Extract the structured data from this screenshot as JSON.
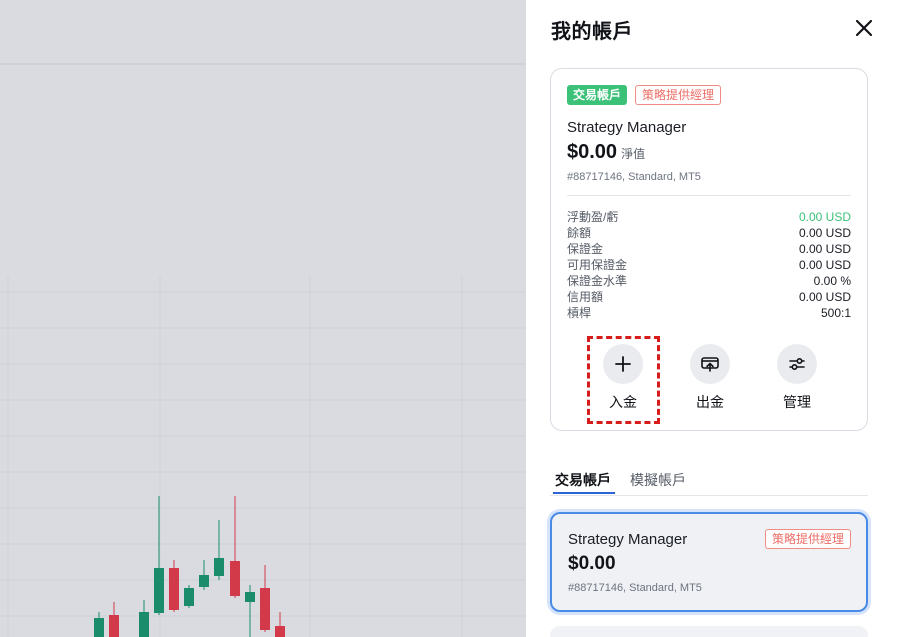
{
  "panel": {
    "title": "我的帳戶",
    "close_icon": "close-icon"
  },
  "account_card": {
    "badge_type": "交易帳戶",
    "badge_role": "策略提供經理",
    "name": "Strategy Manager",
    "balance": "$0.00",
    "balance_label": "淨值",
    "meta": "#88717146, Standard, MT5",
    "stats": [
      {
        "label": "浮動盈/虧",
        "value": "0.00 USD",
        "positive": true
      },
      {
        "label": "餘額",
        "value": "0.00 USD"
      },
      {
        "label": "保證金",
        "value": "0.00 USD"
      },
      {
        "label": "可用保證金",
        "value": "0.00 USD"
      },
      {
        "label": "保證金水準",
        "value": "0.00 %"
      },
      {
        "label": "信用額",
        "value": "0.00 USD"
      },
      {
        "label": "槓桿",
        "value": "500:1"
      }
    ],
    "actions": {
      "deposit": {
        "label": "入金",
        "icon": "plus-icon"
      },
      "withdraw": {
        "label": "出金",
        "icon": "withdraw-icon"
      },
      "manage": {
        "label": "管理",
        "icon": "sliders-icon"
      }
    }
  },
  "tabs": [
    {
      "label": "交易帳戶",
      "active": true
    },
    {
      "label": "模擬帳戶",
      "active": false
    }
  ],
  "account_list": [
    {
      "name": "Strategy Manager",
      "badge": "策略提供經理",
      "balance": "$0.00",
      "meta": "#88717146, Standard, MT5"
    }
  ],
  "colors": {
    "positive": "#3cc178",
    "badge_outline": "#ec6d66",
    "highlight": "#d81b1b",
    "selected_border": "#4a8be6",
    "overlay": "#d9dbe0"
  }
}
